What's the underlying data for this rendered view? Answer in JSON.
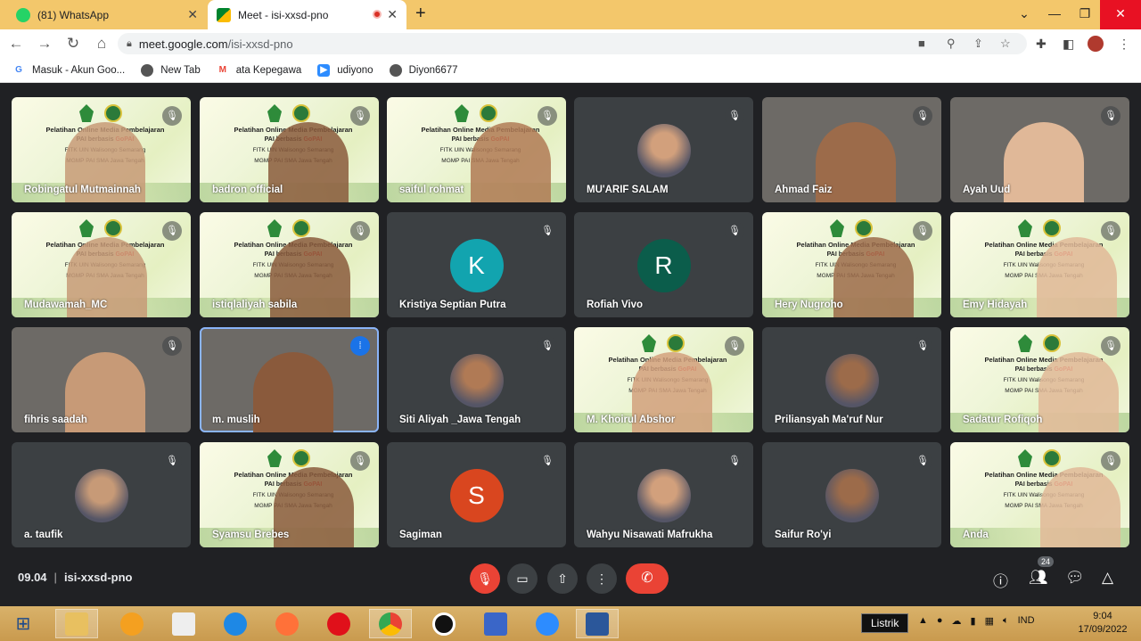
{
  "browser": {
    "tabs": [
      {
        "title": "(81) WhatsApp",
        "icon": "whatsapp-icon",
        "active": false
      },
      {
        "title": "Meet - isi-xxsd-pno",
        "icon": "meet-icon",
        "active": true
      }
    ],
    "url_host": "meet.google.com",
    "url_path": "/isi-xxsd-pno",
    "bookmarks": [
      {
        "label": "Masuk - Akun Goo...",
        "icon": "google-icon"
      },
      {
        "label": "New Tab",
        "icon": "globe-icon"
      },
      {
        "label": "ata Kepegawa",
        "icon": "gmail-icon"
      },
      {
        "label": "udiyono",
        "icon": "zoom-icon"
      },
      {
        "label": "Diyon6677",
        "icon": "globe-icon"
      }
    ]
  },
  "slide": {
    "line1": "Pelatihan Online Media Pembelajaran",
    "line2a": "PAI berbasis ",
    "line2b": "GoPAI",
    "line3": "FITK UIN Walisongo Semarang",
    "line4": "MGMP PAI SMA Jawa Tengah"
  },
  "participants": [
    {
      "name": "Robingatul Mutmainnah",
      "avatar_letter": ""
    },
    {
      "name": "badron official",
      "avatar_letter": ""
    },
    {
      "name": "saiful rohmat",
      "avatar_letter": ""
    },
    {
      "name": "MU'ARIF SALAM",
      "avatar_letter": ""
    },
    {
      "name": "Ahmad Faiz",
      "avatar_letter": ""
    },
    {
      "name": "Ayah Uud",
      "avatar_letter": ""
    },
    {
      "name": "Mudawamah_MC",
      "avatar_letter": ""
    },
    {
      "name": "istiqlaliyah sabila",
      "avatar_letter": ""
    },
    {
      "name": "Kristiya Septian Putra",
      "avatar_letter": "K"
    },
    {
      "name": "Rofiah Vivo",
      "avatar_letter": "R"
    },
    {
      "name": "Hery Nugroho",
      "avatar_letter": ""
    },
    {
      "name": "Emy Hidayah",
      "avatar_letter": ""
    },
    {
      "name": "fihris saadah",
      "avatar_letter": ""
    },
    {
      "name": "m. muslih",
      "avatar_letter": ""
    },
    {
      "name": "Siti Aliyah _Jawa Tengah",
      "avatar_letter": ""
    },
    {
      "name": "M. Khoirul Abshor",
      "avatar_letter": ""
    },
    {
      "name": "Priliansyah Ma'ruf Nur",
      "avatar_letter": ""
    },
    {
      "name": "Sadatur Rofiqoh",
      "avatar_letter": ""
    },
    {
      "name": "a. taufik",
      "avatar_letter": ""
    },
    {
      "name": "Syamsu Brebes",
      "avatar_letter": ""
    },
    {
      "name": "Sagiman",
      "avatar_letter": "S"
    },
    {
      "name": "Wahyu Nisawati Mafrukha",
      "avatar_letter": ""
    },
    {
      "name": "Saifur Ro'yi",
      "avatar_letter": ""
    },
    {
      "name": "Anda",
      "avatar_letter": ""
    }
  ],
  "meeting": {
    "time": "09.04",
    "code": "isi-xxsd-pno",
    "participant_count": "24"
  },
  "taskbar": {
    "tooltip": "Listrik",
    "language": "IND",
    "clock_time": "9:04",
    "clock_date": "17/09/2022"
  },
  "colors": {
    "meet_bg": "#202124",
    "tile_bg": "#3c4043",
    "end_call": "#ea4335",
    "tab_strip": "#f3c76b",
    "avatar_K": "#12a4af",
    "avatar_R": "#0b5d4b",
    "avatar_S": "#d9461f"
  }
}
